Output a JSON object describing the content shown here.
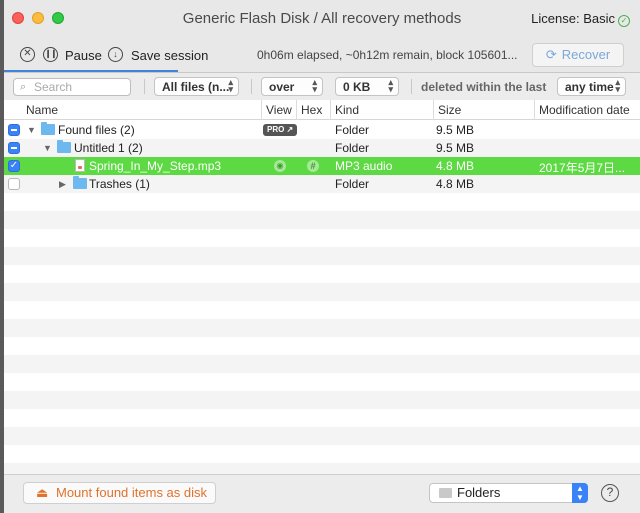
{
  "window": {
    "title": "Generic Flash Disk / All recovery methods",
    "license_label": "License: Basic",
    "license_icon": "check-circle-icon"
  },
  "session": {
    "stop_icon": "close-circle-icon",
    "pause_label": "Pause",
    "pause_icon": "pause-circle-icon",
    "save_label": "Save session",
    "save_icon": "download-circle-icon",
    "progress": "0h06m elapsed, ~0h12m remain, block 105601...",
    "recover_label": "Recover",
    "recover_icon": "refresh-icon"
  },
  "filters": {
    "search_placeholder": "Search",
    "file_type": "All files (n...",
    "size_compare": "over",
    "size_value": "0 KB",
    "deleted_label": "deleted within the last",
    "time_range": "any time"
  },
  "table": {
    "columns": [
      "Name",
      "View",
      "Hex",
      "Kind",
      "Size",
      "Modification date"
    ],
    "rows": [
      {
        "checkbox": "mixed",
        "expanded": true,
        "icon": "folder-icon",
        "name": "Found files (2)",
        "view": "PRO ↗",
        "kind": "Folder",
        "size": "9.5 MB",
        "date": ""
      },
      {
        "checkbox": "mixed",
        "expanded": true,
        "icon": "folder-icon",
        "name": "Untitled 1 (2)",
        "view": "",
        "kind": "Folder",
        "size": "9.5 MB",
        "date": ""
      },
      {
        "checkbox": "checked",
        "expanded": null,
        "icon": "audio-file-icon",
        "name": "Spring_In_My_Step.mp3",
        "view": "eye-icon",
        "hex": "hash-icon",
        "kind": "MP3 audio",
        "size": "4.8 MB",
        "date": "2017年5月7日...",
        "selected": true
      },
      {
        "checkbox": "empty",
        "expanded": false,
        "icon": "folder-icon",
        "name": "Trashes (1)",
        "view": "",
        "kind": "Folder",
        "size": "4.8 MB",
        "date": ""
      }
    ]
  },
  "bottom": {
    "mount_label": "Mount found items as disk",
    "mount_icon": "disk-icon",
    "view_mode": "Folders",
    "help_label": "?"
  },
  "colors": {
    "selection": "#5dd943",
    "accent": "#3a82f7",
    "mount_text": "#e0722c"
  }
}
